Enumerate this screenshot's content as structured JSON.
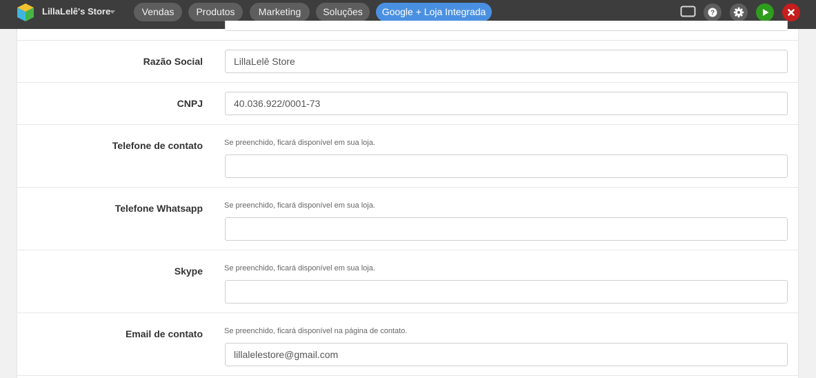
{
  "header": {
    "store_name": "LillaLelê's Store",
    "nav": [
      {
        "label": "Vendas"
      },
      {
        "label": "Produtos"
      },
      {
        "label": "Marketing"
      },
      {
        "label": "Soluções"
      },
      {
        "label": "Google + Loja Integrada",
        "highlight": true
      }
    ],
    "icons": [
      "screen-icon",
      "help-icon",
      "gear-icon",
      "play-icon",
      "close-icon"
    ],
    "colors": {
      "bar": "#3d3d3d",
      "pill": "#5e5e5e",
      "highlight": "#4a90e2",
      "play": "#2e9c1e",
      "close": "#c71d1d"
    }
  },
  "form": {
    "rows": [
      {
        "label": "Razão Social",
        "help": "",
        "value": "LillaLelê Store"
      },
      {
        "label": "CNPJ",
        "help": "",
        "value": "40.036.922/0001-73"
      },
      {
        "label": "Telefone de contato",
        "help": "Se preenchido, ficará disponível em sua loja.",
        "value": ""
      },
      {
        "label": "Telefone Whatsapp",
        "help": "Se preenchido, ficará disponível em sua loja.",
        "value": ""
      },
      {
        "label": "Skype",
        "help": "Se preenchido, ficará disponível em sua loja.",
        "value": ""
      },
      {
        "label": "Email de contato",
        "help": "Se preenchido, ficará disponível na página de contato.",
        "value": "lillalelestore@gmail.com"
      }
    ]
  }
}
